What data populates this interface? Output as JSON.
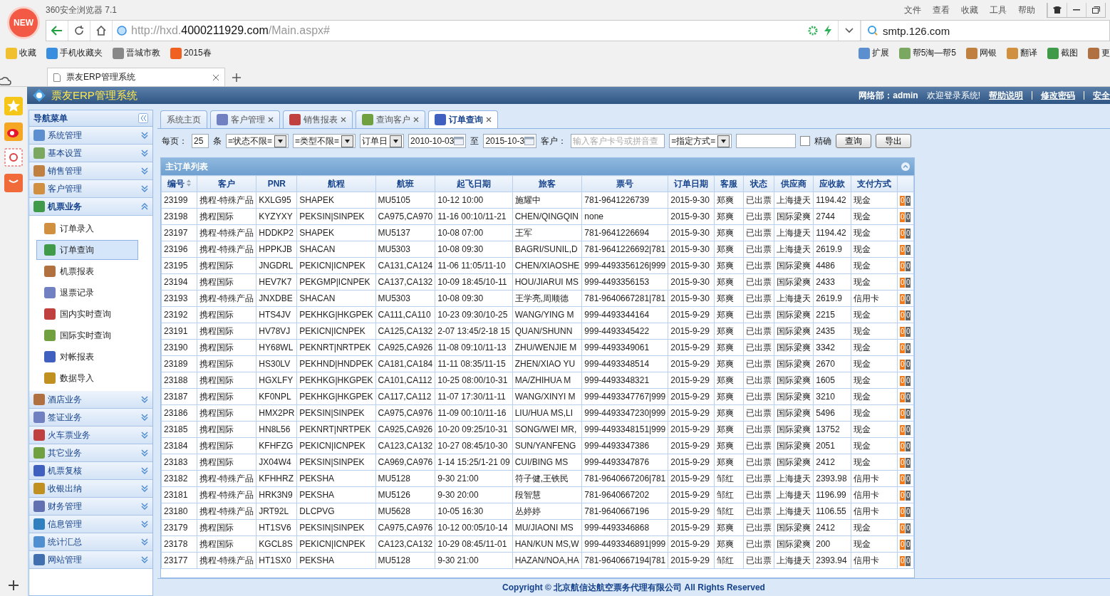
{
  "browser": {
    "logo_text": "NEW",
    "title": "360安全浏览器 7.1",
    "menu": [
      "文件",
      "查看",
      "收藏",
      "工具",
      "帮助"
    ],
    "url_prefix": "http://hxd.",
    "url_domain": "4000211929.com",
    "url_path": "/Main.aspx#",
    "search": "smtp.126.com",
    "bookmarks": [
      "收藏",
      "手机收藏夹",
      "晋城市教",
      "2015春"
    ],
    "extensions": [
      "扩展",
      "帮5淘—帮5",
      "网银",
      "翻译",
      "截图",
      "更"
    ],
    "tabs": [
      {
        "label": "票友ERP管理系统",
        "selected": true
      }
    ]
  },
  "app": {
    "title": "票友ERP管理系统",
    "user": "网络部：admin",
    "welcome": "欢迎登录系统!",
    "links": [
      "帮助说明",
      "修改密码",
      "安全"
    ]
  },
  "sidebar": {
    "title": "导航菜单",
    "groups": [
      {
        "label": "系统管理",
        "expanded": false
      },
      {
        "label": "基本设置",
        "expanded": false
      },
      {
        "label": "销售管理",
        "expanded": false
      },
      {
        "label": "客户管理",
        "expanded": false
      },
      {
        "label": "机票业务",
        "expanded": true,
        "items": [
          {
            "label": "订单录入",
            "selected": false
          },
          {
            "label": "订单查询",
            "selected": true
          },
          {
            "label": "机票报表",
            "selected": false
          },
          {
            "label": "退票记录",
            "selected": false
          },
          {
            "label": "国内实时查询",
            "selected": false
          },
          {
            "label": "国际实时查询",
            "selected": false
          },
          {
            "label": "对帐报表",
            "selected": false
          },
          {
            "label": "数据导入",
            "selected": false
          }
        ]
      },
      {
        "label": "酒店业务",
        "expanded": false
      },
      {
        "label": "签证业务",
        "expanded": false
      },
      {
        "label": "火车票业务",
        "expanded": false
      },
      {
        "label": "其它业务",
        "expanded": false
      },
      {
        "label": "机票复核",
        "expanded": false
      },
      {
        "label": "收银出纳",
        "expanded": false
      },
      {
        "label": "财务管理",
        "expanded": false
      },
      {
        "label": "信息管理",
        "expanded": false
      },
      {
        "label": "统计汇总",
        "expanded": false
      },
      {
        "label": "网站管理",
        "expanded": false
      }
    ]
  },
  "tabs": [
    {
      "label": "系统主页",
      "closable": false,
      "selected": false
    },
    {
      "label": "客户管理",
      "closable": true,
      "selected": false
    },
    {
      "label": "销售报表",
      "closable": true,
      "selected": false
    },
    {
      "label": "查询客户",
      "closable": true,
      "selected": false
    },
    {
      "label": "订单查询",
      "closable": true,
      "selected": true
    }
  ],
  "filter": {
    "per_page_label": "每页：",
    "per_page": "25",
    "per_page_unit": "条",
    "status": "=状态不限=",
    "type": "=类型不限=",
    "date_kind": "订单日",
    "date_from": "2010-10-03",
    "to_label": "至",
    "date_to": "2015-10-3",
    "customer_label": "客户：",
    "customer_placeholder": "输入客户卡号或拼音查",
    "method": "=指定方式=",
    "exact_label": "精确",
    "exact_checked": false,
    "buttons": [
      "查询",
      "导出"
    ]
  },
  "table": {
    "title": "主订单列表",
    "columns": [
      "编号",
      "客户",
      "PNR",
      "航程",
      "航班",
      "起飞日期",
      "旅客",
      "票号",
      "订单日期",
      "客服",
      "状态",
      "供应商",
      "应收款",
      "支付方式"
    ],
    "rows": [
      {
        "cells": [
          "23199",
          "携程-特殊产品",
          "KXLG95",
          "SHAPEK",
          "MU5105",
          "10-12 10:00",
          "施耀中",
          "781-9641226739",
          "2015-9-30",
          "郑爽",
          "已出票",
          "上海捷天",
          "1194.42",
          "现金"
        ],
        "badges": [
          "0",
          "0"
        ]
      },
      {
        "cells": [
          "23198",
          "携程国际",
          "KYZYXY",
          "PEKSIN|SINPEK",
          "CA975,CA970",
          "11-16 00:10/11-21",
          "CHEN/QINGQIN",
          "none",
          "2015-9-30",
          "郑爽",
          "已出票",
          "国际梁爽",
          "2744",
          "现金"
        ],
        "badges": [
          "0",
          "0"
        ]
      },
      {
        "cells": [
          "23197",
          "携程-特殊产品",
          "HDDKP2",
          "SHAPEK",
          "MU5137",
          "10-08 07:00",
          "王军",
          "781-9641226694",
          "2015-9-30",
          "郑爽",
          "已出票",
          "上海捷天",
          "1194.42",
          "现金"
        ],
        "badges": [
          "0",
          "0"
        ]
      },
      {
        "cells": [
          "23196",
          "携程-特殊产品",
          "HPPKJB",
          "SHACAN",
          "MU5303",
          "10-08 09:30",
          "BAGRI/SUNIL,D",
          "781-9641226692|781",
          "2015-9-30",
          "郑爽",
          "已出票",
          "上海捷天",
          "2619.9",
          "现金"
        ],
        "badges": [
          "0",
          "0"
        ]
      },
      {
        "cells": [
          "23195",
          "携程国际",
          "JNGDRL",
          "PEKICN|ICNPEK",
          "CA131,CA124",
          "11-06 11:05/11-10",
          "CHEN/XIAOSHE",
          "999-4493356126|999",
          "2015-9-30",
          "郑爽",
          "已出票",
          "国际梁爽",
          "4486",
          "现金"
        ],
        "badges": [
          "0",
          "0"
        ]
      },
      {
        "cells": [
          "23194",
          "携程国际",
          "HEV7K7",
          "PEKGMP|ICNPEK",
          "CA137,CA132",
          "10-09 18:45/10-11",
          "HOU/JIARUI MS",
          "999-4493356153",
          "2015-9-30",
          "郑爽",
          "已出票",
          "国际梁爽",
          "2433",
          "现金"
        ],
        "badges": [
          "0",
          "0"
        ]
      },
      {
        "cells": [
          "23193",
          "携程-特殊产品",
          "JNXDBE",
          "SHACAN",
          "MU5303",
          "10-08 09:30",
          "王学亮,周顺德",
          "781-9640667281|781",
          "2015-9-30",
          "郑爽",
          "已出票",
          "上海捷天",
          "2619.9",
          "信用卡"
        ],
        "badges": [
          "0",
          "0"
        ]
      },
      {
        "cells": [
          "23192",
          "携程国际",
          "HTS4JV",
          "PEKHKG|HKGPEK",
          "CA111,CA110",
          "10-23 09:30/10-25",
          "WANG/YING M",
          "999-4493344164",
          "2015-9-29",
          "郑爽",
          "已出票",
          "国际梁爽",
          "2215",
          "现金"
        ],
        "badges": [
          "0",
          "0"
        ]
      },
      {
        "cells": [
          "23191",
          "携程国际",
          "HV78VJ",
          "PEKICN|ICNPEK",
          "CA125,CA132",
          "2-07 13:45/2-18 15",
          "QUAN/SHUNN",
          "999-4493345422",
          "2015-9-29",
          "郑爽",
          "已出票",
          "国际梁爽",
          "2435",
          "现金"
        ],
        "badges": [
          "0",
          "0"
        ]
      },
      {
        "cells": [
          "23190",
          "携程国际",
          "HY68WL",
          "PEKNRT|NRTPEK",
          "CA925,CA926",
          "11-08 09:10/11-13",
          "ZHU/WENJIE M",
          "999-4493349061",
          "2015-9-29",
          "郑爽",
          "已出票",
          "国际梁爽",
          "3342",
          "现金"
        ],
        "badges": [
          "0",
          "0"
        ]
      },
      {
        "cells": [
          "23189",
          "携程国际",
          "HS30LV",
          "PEKHND|HNDPEK",
          "CA181,CA184",
          "11-11 08:35/11-15",
          "ZHEN/XIAO YU",
          "999-4493348514",
          "2015-9-29",
          "郑爽",
          "已出票",
          "国际梁爽",
          "2670",
          "现金"
        ],
        "badges": [
          "0",
          "0"
        ]
      },
      {
        "cells": [
          "23188",
          "携程国际",
          "HGXLFY",
          "PEKHKG|HKGPEK",
          "CA101,CA112",
          "10-25 08:00/10-31",
          "MA/ZHIHUA M",
          "999-4493348321",
          "2015-9-29",
          "郑爽",
          "已出票",
          "国际梁爽",
          "1605",
          "现金"
        ],
        "badges": [
          "0",
          "0"
        ]
      },
      {
        "cells": [
          "23187",
          "携程国际",
          "KF0NPL",
          "PEKHKG|HKGPEK",
          "CA117,CA112",
          "11-07 17:30/11-11",
          "WANG/XINYI M",
          "999-4493347767|999",
          "2015-9-29",
          "郑爽",
          "已出票",
          "国际梁爽",
          "3210",
          "现金"
        ],
        "badges": [
          "0",
          "0"
        ]
      },
      {
        "cells": [
          "23186",
          "携程国际",
          "HMX2PR",
          "PEKSIN|SINPEK",
          "CA975,CA976",
          "11-09 00:10/11-16",
          "LIU/HUA MS,LI",
          "999-4493347230|999",
          "2015-9-29",
          "郑爽",
          "已出票",
          "国际梁爽",
          "5496",
          "现金"
        ],
        "badges": [
          "0",
          "0"
        ]
      },
      {
        "cells": [
          "23185",
          "携程国际",
          "HN8L56",
          "PEKNRT|NRTPEK",
          "CA925,CA926",
          "10-20 09:25/10-31",
          "SONG/WEI MR,",
          "999-4493348151|999",
          "2015-9-29",
          "郑爽",
          "已出票",
          "国际梁爽",
          "13752",
          "现金"
        ],
        "badges": [
          "0",
          "0"
        ]
      },
      {
        "cells": [
          "23184",
          "携程国际",
          "KFHFZG",
          "PEKICN|ICNPEK",
          "CA123,CA132",
          "10-27 08:45/10-30",
          "SUN/YANFENG",
          "999-4493347386",
          "2015-9-29",
          "郑爽",
          "已出票",
          "国际梁爽",
          "2051",
          "现金"
        ],
        "badges": [
          "0",
          "0"
        ]
      },
      {
        "cells": [
          "23183",
          "携程国际",
          "JX04W4",
          "PEKSIN|SINPEK",
          "CA969,CA976",
          "1-14 15:25/1-21 09",
          "CUI/BING MS",
          "999-4493347876",
          "2015-9-29",
          "郑爽",
          "已出票",
          "国际梁爽",
          "2412",
          "现金"
        ],
        "badges": [
          "0",
          "0"
        ]
      },
      {
        "cells": [
          "23182",
          "携程-特殊产品",
          "KFHHRZ",
          "PEKSHA",
          "MU5128",
          "9-30 21:00",
          "符子健,王铁民",
          "781-9640667206|781",
          "2015-9-29",
          "邹红",
          "已出票",
          "上海捷天",
          "2393.98",
          "信用卡"
        ],
        "badges": [
          "0",
          "0"
        ]
      },
      {
        "cells": [
          "23181",
          "携程-特殊产品",
          "HRK3N9",
          "PEKSHA",
          "MU5126",
          "9-30 20:00",
          "段智慧",
          "781-9640667202",
          "2015-9-29",
          "邹红",
          "已出票",
          "上海捷天",
          "1196.99",
          "信用卡"
        ],
        "badges": [
          "0",
          "0"
        ]
      },
      {
        "cells": [
          "23180",
          "携程-特殊产品",
          "JRT92L",
          "DLCPVG",
          "MU5628",
          "10-05 16:30",
          "丛婷婷",
          "781-9640667196",
          "2015-9-29",
          "邹红",
          "已出票",
          "上海捷天",
          "1106.55",
          "信用卡"
        ],
        "badges": [
          "0",
          "0"
        ]
      },
      {
        "cells": [
          "23179",
          "携程国际",
          "HT1SV6",
          "PEKSIN|SINPEK",
          "CA975,CA976",
          "10-12 00:05/10-14",
          "MU/JIAONI MS",
          "999-4493346868",
          "2015-9-29",
          "郑爽",
          "已出票",
          "国际梁爽",
          "2412",
          "现金"
        ],
        "badges": [
          "0",
          "0"
        ]
      },
      {
        "cells": [
          "23178",
          "携程国际",
          "KGCL8S",
          "PEKICN|ICNPEK",
          "CA123,CA132",
          "10-29 08:45/11-01",
          "HAN/KUN MS,W",
          "999-4493346891|999",
          "2015-9-29",
          "郑爽",
          "已出票",
          "国际梁爽",
          "200",
          "现金"
        ],
        "badges": [
          "0",
          "0"
        ]
      },
      {
        "cells": [
          "23177",
          "携程-特殊产品",
          "HT1SX0",
          "PEKSHA",
          "MU5128",
          "9-30 21:00",
          "HAZAN/NOA,HA",
          "781-9640667194|781",
          "2015-9-29",
          "邹红",
          "已出票",
          "上海捷天",
          "2393.94",
          "信用卡"
        ],
        "badges": [
          "0",
          "0"
        ]
      }
    ]
  },
  "footer": "Copyright © 北京航信达航空票务代理有限公司 All Rights Reserved"
}
